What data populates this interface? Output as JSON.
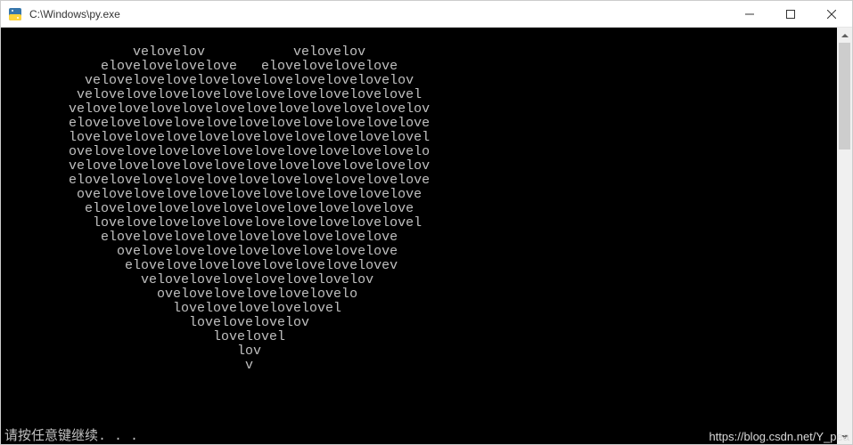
{
  "window": {
    "title": "C:\\Windows\\py.exe"
  },
  "console": {
    "lines": [
      "",
      "                velovelov           velovelov",
      "            elovelovelovelove   elovelovelovelove",
      "          velovelovelovelovelovelovelovelovelovelov",
      "         velovelovelovelovelovelovelovelovelovelovel",
      "        velovelovelovelovelovelovelovelovelovelovelov",
      "        elovelovelovelovelovelovelovelovelovelovelove",
      "        lovelovelovelovelovelovelovelovelovelovelovel",
      "        ovelovelovelovelovelovelovelovelovelovelovelo",
      "        velovelovelovelovelovelovelovelovelovelovelov",
      "        elovelovelovelovelovelovelovelovelovelovelove",
      "         ovelovelovelovelovelovelovelovelovelovelove",
      "          elovelovelovelovelovelovelovelovelovelove",
      "           lovelovelovelovelovelovelovelovelovelovel",
      "            elovelovelovelovelovelovelovelovelove",
      "              ovelovelovelovelovelovelovelovelove",
      "               elovelovelovelovelovelovelovelovev",
      "                 velovelovelovelovelovelovelov",
      "                   ovelovelovelovelovelovelo",
      "                     lovelovelovelovelovel",
      "                       lovelovelovelov",
      "                          lovelovel",
      "                             lov",
      "                              v",
      "",
      "",
      "",
      ""
    ],
    "prompt": "请按任意键继续. . ."
  },
  "watermark": "https://blog.csdn.net/Y_pea"
}
